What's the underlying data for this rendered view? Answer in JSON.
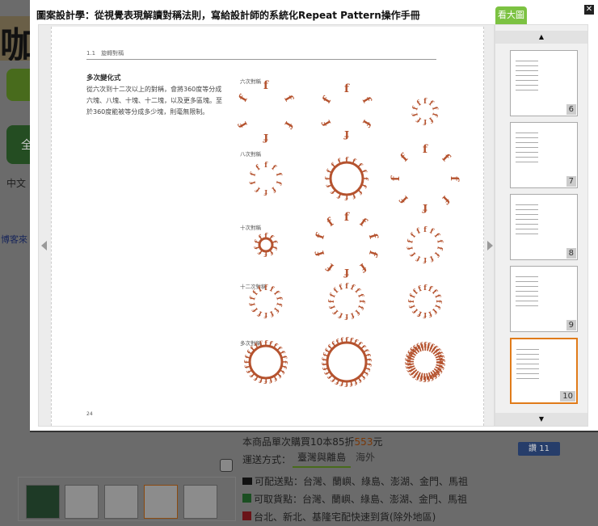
{
  "modal": {
    "title": "圖案設計學：從視覺表現解讀對稱法則，寫給設計師的系統化Repeat Pattern操作手冊",
    "view_large_label": "看大圖",
    "close_label": "✕"
  },
  "page": {
    "header": "1.1　旋轉對稱",
    "section_title": "多次變化式",
    "body": "從六次到十二次以上的對稱，會將360度等分成六塊、八塊、十塊、十二塊，以及更多區塊。至於360度能被等分成多少塊，則毫無限制。",
    "row_labels": [
      "六次對稱",
      "八次對稱",
      "十次對稱",
      "十二次對稱",
      "多次對稱"
    ],
    "page_number": "24"
  },
  "thumbnails": [
    {
      "num": "6"
    },
    {
      "num": "7"
    },
    {
      "num": "8"
    },
    {
      "num": "9"
    },
    {
      "num": "10",
      "selected": true
    }
  ],
  "background": {
    "price_line_prefix": "本商品單次購買10本85折",
    "price": "553",
    "price_suffix": "元",
    "shipping_label": "運送方式：",
    "shipping_tabs": [
      "臺灣與離島",
      "海外"
    ],
    "delivery": "可配送點：台灣、蘭嶼、綠島、澎湖、金門、馬祖",
    "pickup": "可取貨點：台灣、蘭嶼、綠島、澎湖、金門、馬祖",
    "express": "台北、新北、基隆宅配快速到貨(除外地區)",
    "like_label": "讚 11",
    "left_texts": [
      "全",
      "中文",
      "博客來"
    ],
    "logo": "咖"
  },
  "colors": {
    "accent": "#7cc242",
    "pattern": "#b5532f",
    "selected": "#e07b1a"
  }
}
